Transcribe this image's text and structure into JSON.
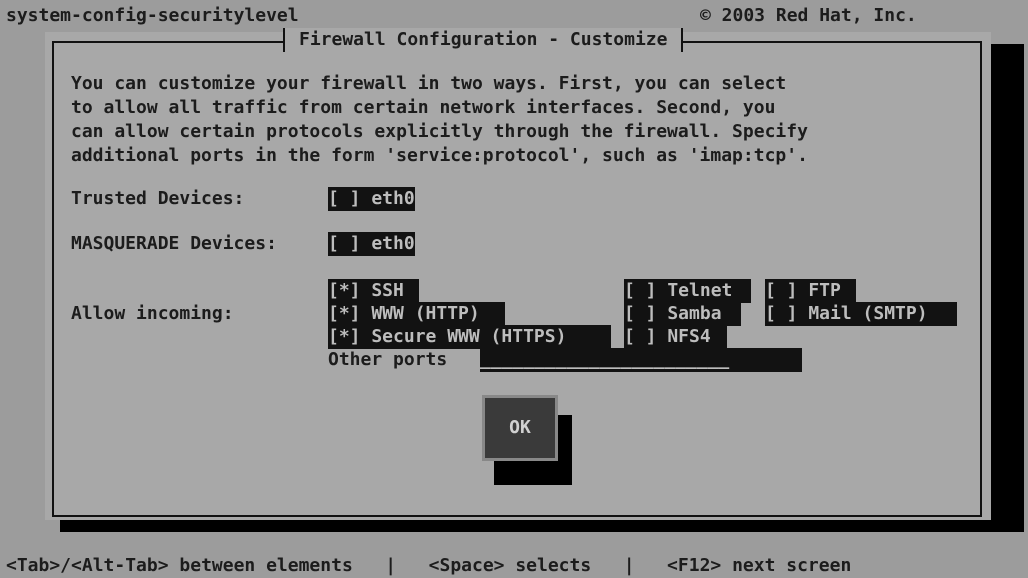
{
  "header": {
    "app_name": "system-config-securitylevel",
    "copyright": "© 2003 Red Hat, Inc."
  },
  "dialog": {
    "title": "Firewall Configuration - Customize",
    "description": [
      "You can customize your firewall in two ways. First, you can select",
      "to allow all traffic from certain network interfaces. Second, you",
      "can allow certain protocols explicitly through the firewall. Specify",
      "additional ports in the form 'service:protocol', such as 'imap:tcp'."
    ],
    "trusted_label": "Trusted Devices:",
    "trusted_eth0": "[ ] eth0",
    "masq_label": "MASQUERADE Devices:",
    "masq_eth0": "[ ] eth0",
    "allow_label": "Allow incoming:",
    "services": {
      "ssh": "[*] SSH",
      "http": "[*] WWW (HTTP)",
      "https": "[*] Secure WWW (HTTPS)",
      "telnet": "[ ] Telnet",
      "samba": "[ ] Samba",
      "nfs4": "[ ] NFS4",
      "ftp": "[ ] FTP",
      "smtp": "[ ] Mail (SMTP)"
    },
    "other_ports_label": "Other ports",
    "other_ports_value": "_______________________",
    "ok_label": "OK"
  },
  "footer": {
    "hint": "<Tab>/<Alt-Tab> between elements   |   <Space> selects   |   <F12> next screen"
  }
}
